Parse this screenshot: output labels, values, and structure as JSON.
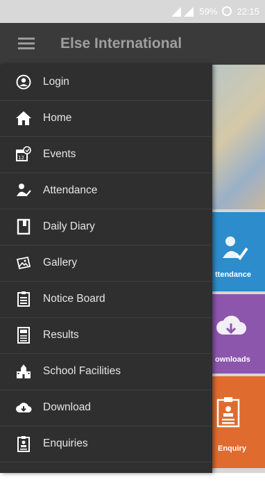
{
  "status": {
    "battery": "59%",
    "time": "22:15"
  },
  "appbar": {
    "title": "Else International"
  },
  "menu": [
    {
      "label": "Login",
      "icon": "login-icon"
    },
    {
      "label": "Home",
      "icon": "home-icon"
    },
    {
      "label": "Events",
      "icon": "calendar-icon"
    },
    {
      "label": "Attendance",
      "icon": "attendance-icon"
    },
    {
      "label": "Daily Diary",
      "icon": "diary-icon"
    },
    {
      "label": "Gallery",
      "icon": "gallery-icon"
    },
    {
      "label": "Notice Board",
      "icon": "notice-board-icon"
    },
    {
      "label": "Results",
      "icon": "results-icon"
    },
    {
      "label": "School Facilities",
      "icon": "school-icon"
    },
    {
      "label": "Download",
      "icon": "download-icon"
    },
    {
      "label": "Enquiries",
      "icon": "enquiries-icon"
    }
  ],
  "cards": {
    "attendance": "ttendance",
    "downloads": "ownloads",
    "enquiry": "Enquiry"
  }
}
